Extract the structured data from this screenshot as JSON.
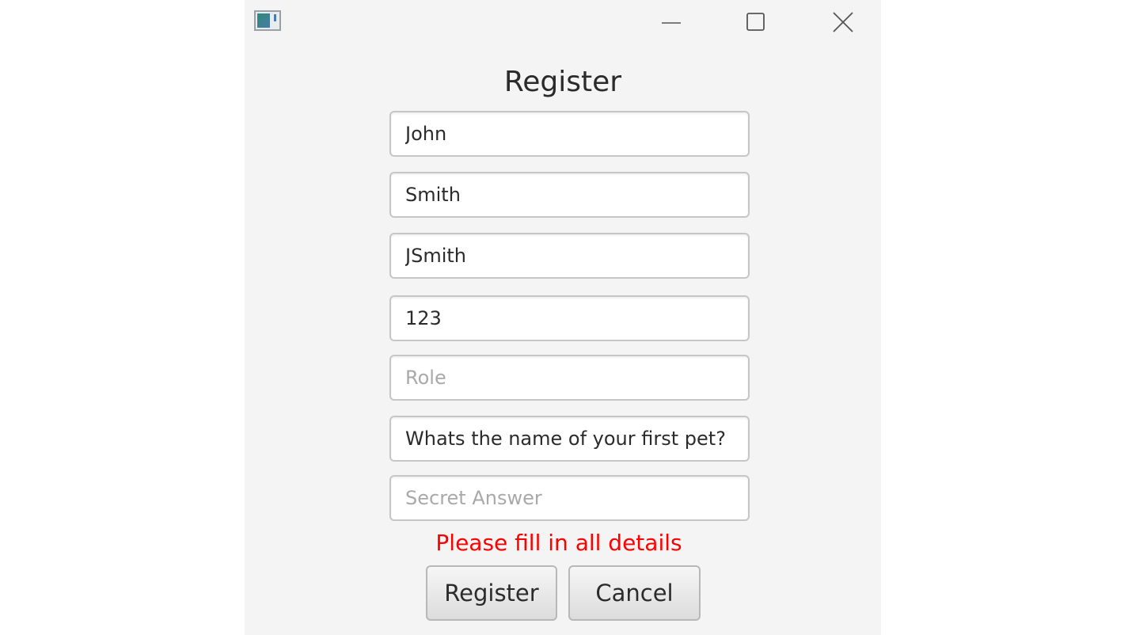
{
  "window": {
    "controls": {
      "minimize_icon": "minimize-icon",
      "maximize_icon": "maximize-icon",
      "close_icon": "close-icon"
    }
  },
  "form": {
    "heading": "Register",
    "fields": [
      {
        "name": "first-name-field",
        "value": "John",
        "placeholder": ""
      },
      {
        "name": "last-name-field",
        "value": "Smith",
        "placeholder": ""
      },
      {
        "name": "username-field",
        "value": "JSmith",
        "placeholder": ""
      },
      {
        "name": "password-field",
        "value": "123",
        "placeholder": ""
      },
      {
        "name": "role-field",
        "value": "",
        "placeholder": "Role"
      },
      {
        "name": "secret-question-field",
        "value": "Whats the name of your first pet?",
        "placeholder": ""
      },
      {
        "name": "secret-answer-field",
        "value": "",
        "placeholder": "Secret Answer"
      }
    ],
    "error_message": "Please fill in all details",
    "error_color": "#ff0000",
    "buttons": {
      "register_label": "Register",
      "cancel_label": "Cancel"
    }
  }
}
